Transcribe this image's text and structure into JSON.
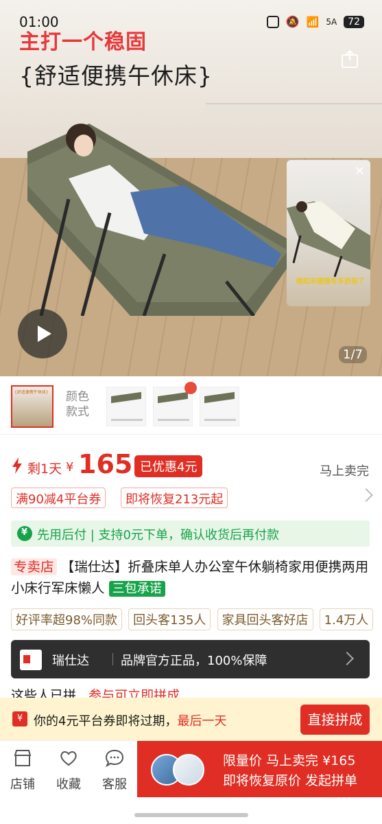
{
  "status": {
    "time": "01:00",
    "battery": "72",
    "network": "5A"
  },
  "hero": {
    "title_line1": "主打一个稳固",
    "title_line2": "{舒适便携午休床}",
    "pager": "1/7",
    "pip_caption": "睡起来腰腿有多舒服了"
  },
  "variants": {
    "label": "颜色\n款式",
    "main_thumb_text": "{舒适便携午休床}"
  },
  "price": {
    "remaining": "剩1天",
    "currency": "¥",
    "value": "165",
    "discount": "已优惠4元",
    "sellout": "马上卖完"
  },
  "coupons": [
    "满90减4平台券",
    "即将恢复213元起"
  ],
  "pay_later": "先用后付 | 支持0元下单，确认收货后再付款",
  "title": {
    "store_tag": "专卖店",
    "text": "【瑞仕达】折叠床单人办公室午休躺椅家用便携两用小床行军床懒人",
    "guarantee": "三包承诺"
  },
  "badges": [
    "好评率超98%同款",
    "回头客135人",
    "家具回头客好店",
    "1.4万人"
  ],
  "store": {
    "name": "瑞仕达",
    "claim": "品牌官方正品，100%保障"
  },
  "group": {
    "label": "这些人已拼",
    "action": "参与可立即拼成"
  },
  "expiry": {
    "icon": "¥",
    "text": "你的4元平台券即将过期，",
    "last_day": "最后一天",
    "button": "直接拼成"
  },
  "bottom_nav": [
    {
      "label": "店铺",
      "icon": "store-icon"
    },
    {
      "label": "收藏",
      "icon": "heart-icon"
    },
    {
      "label": "客服",
      "icon": "chat-icon"
    }
  ],
  "cta": {
    "line1": "限量价 马上卖完 ¥165",
    "line2": "即将恢复原价 发起拼单"
  },
  "colors": {
    "accent": "#e02e24",
    "green": "#18a34a",
    "dark": "#2f2f2f",
    "banner": "#fff4cf"
  }
}
